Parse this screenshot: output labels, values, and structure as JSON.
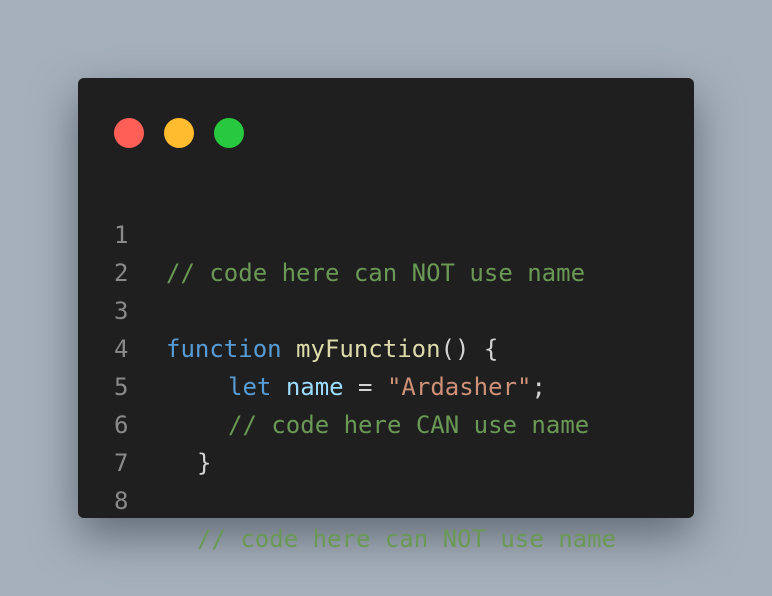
{
  "window": {
    "background": "#1f1f1f",
    "page_background": "#a6b0bb",
    "traffic_lights": [
      {
        "name": "close",
        "color": "#ff5f57"
      },
      {
        "name": "minimize",
        "color": "#febc2e"
      },
      {
        "name": "maximize",
        "color": "#28c840"
      }
    ]
  },
  "colors": {
    "comment": "#6a9955",
    "keyword": "#569cd6",
    "function": "#dcdcaa",
    "variable": "#9cdcfe",
    "string": "#ce9178",
    "punctuation": "#d4d4d4",
    "line_number": "#8a8a8a"
  },
  "code": {
    "lines": [
      {
        "number": "1",
        "tokens": [
          {
            "text": "// code here can NOT use name"
          }
        ]
      },
      {
        "number": "2",
        "tokens": []
      },
      {
        "number": "3",
        "tokens": [
          {
            "text": "function"
          },
          {
            "text": " "
          },
          {
            "text": "myFunction"
          },
          {
            "text": "() {"
          }
        ]
      },
      {
        "number": "4",
        "tokens": [
          {
            "text": "let"
          },
          {
            "text": " "
          },
          {
            "text": "name"
          },
          {
            "text": " = "
          },
          {
            "text": "\"Ardasher\""
          },
          {
            "text": ";"
          }
        ]
      },
      {
        "number": "5",
        "tokens": [
          {
            "text": "// code here CAN use name"
          }
        ]
      },
      {
        "number": "6",
        "tokens": [
          {
            "text": "}"
          }
        ]
      },
      {
        "number": "7",
        "tokens": []
      },
      {
        "number": "8",
        "tokens": [
          {
            "text": "// code here can NOT use name"
          }
        ]
      }
    ]
  }
}
